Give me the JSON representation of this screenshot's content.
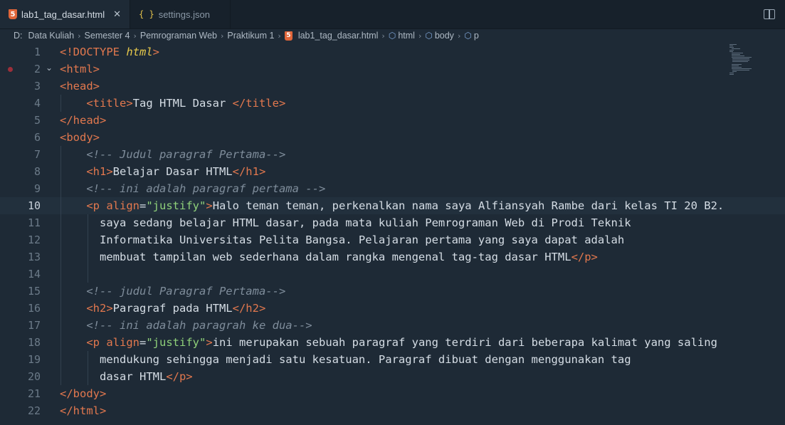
{
  "tabs": [
    {
      "label": "lab1_tag_dasar.html",
      "active": true,
      "icon": "html5-icon"
    },
    {
      "label": "settings.json",
      "active": false,
      "icon": "json-braces-icon"
    }
  ],
  "breadcrumb": [
    "D:",
    "Data Kuliah",
    "Semester 4",
    "Pemrograman Web",
    "Praktikum 1",
    "lab1_tag_dasar.html",
    "html",
    "body",
    "p"
  ],
  "editor": {
    "current_line": 10,
    "lines": [
      {
        "n": "1",
        "segs": [
          [
            "t-doctype",
            "<!DOCTYPE "
          ],
          [
            "t-kw",
            "html"
          ],
          [
            "t-doctype",
            ">"
          ]
        ]
      },
      {
        "n": "2",
        "segs": [
          [
            "t-tag",
            "<html>"
          ]
        ]
      },
      {
        "n": "3",
        "segs": [
          [
            "t-tag",
            "<head>"
          ]
        ]
      },
      {
        "n": "4",
        "segs": [
          [
            "t-text",
            "    "
          ],
          [
            "t-tag",
            "<title>"
          ],
          [
            "t-text",
            "Tag HTML Dasar "
          ],
          [
            "t-tag",
            "</title>"
          ]
        ]
      },
      {
        "n": "5",
        "segs": [
          [
            "t-tag",
            "</head>"
          ]
        ]
      },
      {
        "n": "6",
        "segs": [
          [
            "t-tag",
            "<body>"
          ]
        ]
      },
      {
        "n": "7",
        "segs": [
          [
            "t-text",
            "    "
          ],
          [
            "t-cmt",
            "<!-- Judul paragraf Pertama-->"
          ]
        ]
      },
      {
        "n": "8",
        "segs": [
          [
            "t-text",
            "    "
          ],
          [
            "t-tag",
            "<h1>"
          ],
          [
            "t-text",
            "Belajar Dasar HTML"
          ],
          [
            "t-tag",
            "</h1>"
          ]
        ]
      },
      {
        "n": "9",
        "segs": [
          [
            "t-text",
            "    "
          ],
          [
            "t-cmt",
            "<!-- ini adalah paragraf pertama -->"
          ]
        ]
      },
      {
        "n": "10",
        "segs": [
          [
            "t-text",
            "    "
          ],
          [
            "t-tag",
            "<p "
          ],
          [
            "t-attr",
            "align"
          ],
          [
            "t-text",
            "="
          ],
          [
            "t-str",
            "\"justify\""
          ],
          [
            "t-tag",
            ">"
          ],
          [
            "t-text",
            "Halo teman teman, perkenalkan nama saya Alfiansyah Rambe dari kelas TI 20 B2."
          ]
        ]
      },
      {
        "n": "11",
        "segs": [
          [
            "t-text",
            "      saya sedang belajar HTML dasar, pada mata kuliah Pemrograman Web di Prodi Teknik"
          ]
        ]
      },
      {
        "n": "12",
        "segs": [
          [
            "t-text",
            "      Informatika Universitas Pelita Bangsa. Pelajaran pertama yang saya dapat adalah"
          ]
        ]
      },
      {
        "n": "13",
        "segs": [
          [
            "t-text",
            "      membuat tampilan web sederhana dalam rangka mengenal tag-tag dasar HTML"
          ],
          [
            "t-tag",
            "</p>"
          ]
        ]
      },
      {
        "n": "14",
        "segs": []
      },
      {
        "n": "15",
        "segs": [
          [
            "t-text",
            "    "
          ],
          [
            "t-cmt",
            "<!-- judul Paragraf Pertama-->"
          ]
        ]
      },
      {
        "n": "16",
        "segs": [
          [
            "t-text",
            "    "
          ],
          [
            "t-tag",
            "<h2>"
          ],
          [
            "t-text",
            "Paragraf pada HTML"
          ],
          [
            "t-tag",
            "</h2>"
          ]
        ]
      },
      {
        "n": "17",
        "segs": [
          [
            "t-text",
            "    "
          ],
          [
            "t-cmt",
            "<!-- ini adalah paragrah ke dua-->"
          ]
        ]
      },
      {
        "n": "18",
        "segs": [
          [
            "t-text",
            "    "
          ],
          [
            "t-tag",
            "<p "
          ],
          [
            "t-attr",
            "align"
          ],
          [
            "t-text",
            "="
          ],
          [
            "t-str",
            "\"justify\""
          ],
          [
            "t-tag",
            ">"
          ],
          [
            "t-text",
            "ini merupakan sebuah paragraf yang terdiri dari beberapa kalimat yang saling"
          ]
        ]
      },
      {
        "n": "19",
        "segs": [
          [
            "t-text",
            "      mendukung sehingga menjadi satu kesatuan. Paragraf dibuat dengan menggunakan tag"
          ]
        ]
      },
      {
        "n": "20",
        "segs": [
          [
            "t-text",
            "      dasar HTML"
          ],
          [
            "t-tag",
            "</p>"
          ]
        ]
      },
      {
        "n": "21",
        "segs": [
          [
            "t-tag",
            "</body>"
          ]
        ]
      },
      {
        "n": "22",
        "segs": [
          [
            "t-tag",
            "</html>"
          ]
        ]
      }
    ]
  }
}
